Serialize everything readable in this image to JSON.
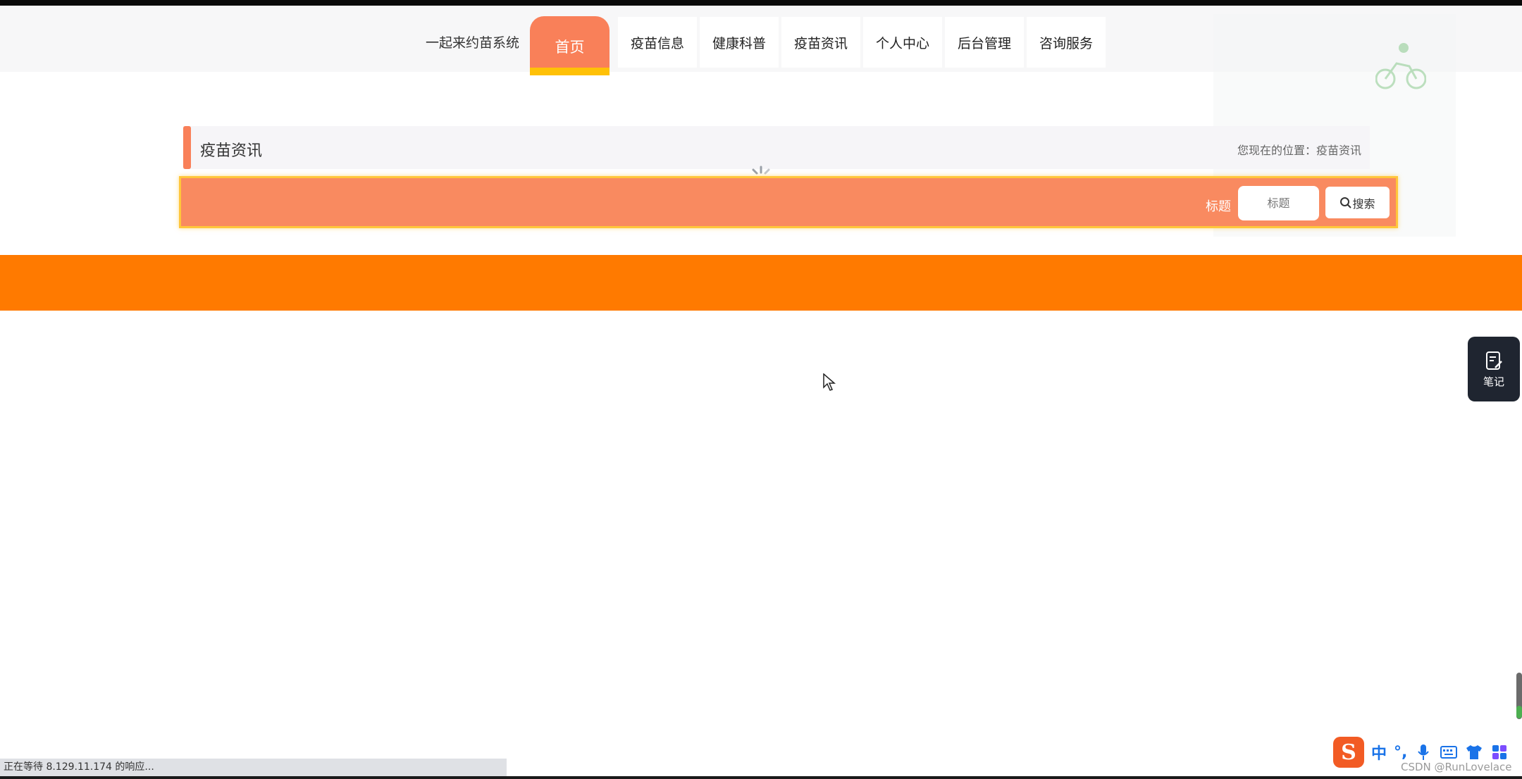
{
  "header": {
    "brand": "一起来约苗系统",
    "nav": [
      {
        "label": "首页",
        "active": true
      },
      {
        "label": "疫苗信息"
      },
      {
        "label": "健康科普"
      },
      {
        "label": "疫苗资讯"
      },
      {
        "label": "个人中心"
      },
      {
        "label": "后台管理"
      },
      {
        "label": "咨询服务"
      }
    ]
  },
  "breadcrumb": {
    "title": "疫苗资讯",
    "location": "您现在的位置：疫苗资讯"
  },
  "search": {
    "label": "标题",
    "placeholder": "标题",
    "button": "搜索"
  },
  "notes_widget": {
    "label": "笔记",
    "icon": "note-edit-icon"
  },
  "status_bar": {
    "text": "正在等待 8.129.11.174 的响应..."
  },
  "ime": {
    "logo": "S",
    "mode": "中",
    "punct": "°,"
  },
  "watermark": "CSDN @RunLovelace",
  "colors": {
    "accent": "#f98059",
    "band": "#ff7a00",
    "highlight": "#ffc107"
  }
}
